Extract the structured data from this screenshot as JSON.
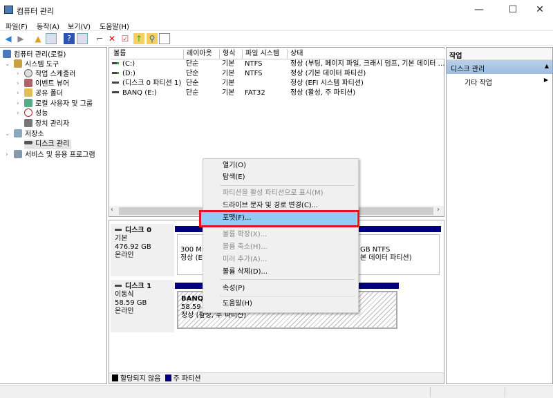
{
  "window": {
    "title": "컴퓨터 관리",
    "minimize": "—",
    "maximize": "☐",
    "close": "✕"
  },
  "menu": [
    "파일(F)",
    "동작(A)",
    "보기(V)",
    "도움말(H)"
  ],
  "toolbar": [
    "back-icon",
    "forward-icon",
    "up-folder-icon",
    "show-hide-tree-icon",
    "help-icon",
    "show-hide-action-icon",
    "connect-icon",
    "delete-icon",
    "properties-icon",
    "new-folder-icon",
    "search-icon",
    "list-icon"
  ],
  "tree": {
    "root": "컴퓨터 관리(로컬)",
    "items": [
      {
        "label": "시스템 도구"
      },
      {
        "label": "작업 스케줄러"
      },
      {
        "label": "이벤트 뷰어"
      },
      {
        "label": "공유 폴더"
      },
      {
        "label": "로컬 사용자 및 그룹"
      },
      {
        "label": "성능"
      },
      {
        "label": "장치 관리자"
      },
      {
        "label": "저장소"
      },
      {
        "label": "디스크 관리"
      },
      {
        "label": "서비스 및 응용 프로그램"
      }
    ]
  },
  "volumes": {
    "columns": [
      "볼륨",
      "레이아웃",
      "형식",
      "파일 시스템",
      "상태"
    ],
    "rows": [
      [
        "(C:)",
        "단순",
        "기본",
        "NTFS",
        "정상 (부팅, 페이지 파일, 크래시 덤프, 기본 데이터 …"
      ],
      [
        "(D:)",
        "단순",
        "기본",
        "NTFS",
        "정상 (기본 데이터 파티션)"
      ],
      [
        "(디스크 0 파티션 1)",
        "단순",
        "기본",
        "",
        "정상 (EFI 시스템 파티션)"
      ],
      [
        "BANQ (E:)",
        "단순",
        "기본",
        "FAT32",
        "정상 (활성, 주 파티션)"
      ]
    ]
  },
  "disks": [
    {
      "name": "디스크 0",
      "type": "기본",
      "size": "476.92 GB",
      "state": "온라인",
      "parts": [
        {
          "l1": "300 MB",
          "l2": "정상 (EFI"
        },
        {
          "l1": "GB NTFS",
          "l2": "본 데이터 파티션)"
        }
      ]
    },
    {
      "name": "디스크 1",
      "type": "이동식",
      "size": "58.59 GB",
      "state": "온라인",
      "parts": [
        {
          "l0": "BANQ",
          "l1": "58.59 G",
          "l2": "정상 (활성, 주 파티션)"
        }
      ]
    }
  ],
  "legend": [
    "할당되지 않음",
    "주 파티션"
  ],
  "legend_colors": [
    "#000000",
    "#000080"
  ],
  "actions": {
    "header": "작업",
    "section": "디스크 관리",
    "item": "기타 작업"
  },
  "context_menu": [
    {
      "label": "열기(O)",
      "enabled": true
    },
    {
      "label": "탐색(E)",
      "enabled": true
    },
    {
      "label": "파티션을 활성 파티션으로 표시(M)",
      "enabled": false
    },
    {
      "label": "드라이브 문자 및 경로 변경(C)...",
      "enabled": true
    },
    {
      "label": "포맷(F)...",
      "enabled": true,
      "highlighted": true
    },
    {
      "label": "볼륨 확장(X)...",
      "enabled": false
    },
    {
      "label": "볼륨 축소(H)...",
      "enabled": false
    },
    {
      "label": "미러 추가(A)...",
      "enabled": false
    },
    {
      "label": "볼륨 삭제(D)...",
      "enabled": true
    },
    {
      "label": "속성(P)",
      "enabled": true
    },
    {
      "label": "도움말(H)",
      "enabled": true
    }
  ]
}
